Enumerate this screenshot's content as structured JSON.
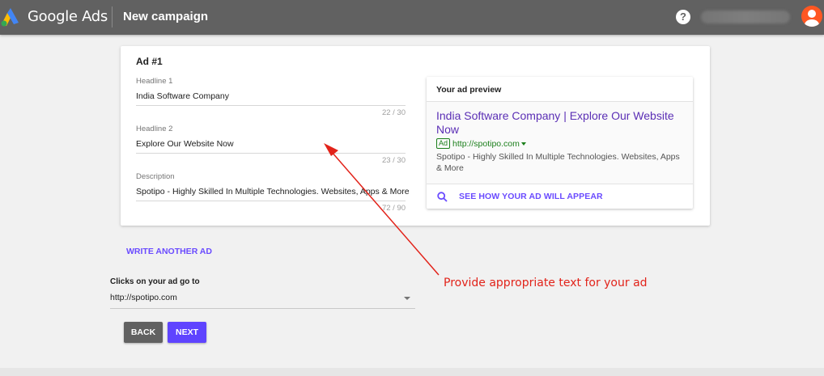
{
  "header": {
    "brand": "Google Ads",
    "title": "New campaign",
    "help_label": "?"
  },
  "ad": {
    "title": "Ad #1",
    "fields": [
      {
        "label": "Headline 1",
        "value": "India Software Company",
        "count": "22 / 30"
      },
      {
        "label": "Headline 2",
        "value": "Explore Our Website Now",
        "count": "23 / 30"
      },
      {
        "label": "Description",
        "value": "Spotipo - Highly Skilled In Multiple Technologies. Websites, Apps & More",
        "count": "72 / 90"
      }
    ]
  },
  "preview": {
    "title": "Your ad preview",
    "headline": "India Software Company | Explore Our Website Now",
    "badge": "Ad",
    "url": "http://spotipo.com",
    "description": "Spotipo - Highly Skilled In Multiple Technologies. Websites, Apps & More",
    "action_label": "SEE HOW YOUR AD WILL APPEAR"
  },
  "write_another_label": "WRITE ANOTHER AD",
  "destination": {
    "label": "Clicks on your ad go to",
    "value": "http://spotipo.com"
  },
  "buttons": {
    "back": "BACK",
    "next": "NEXT"
  },
  "annotation": {
    "text": "Provide appropriate text for your ad",
    "color": "#e2231a"
  },
  "colors": {
    "topbar": "#616161",
    "accent": "#6a4bff",
    "ad_headline": "#5b2fb5",
    "ad_url": "#1b7f1b"
  }
}
